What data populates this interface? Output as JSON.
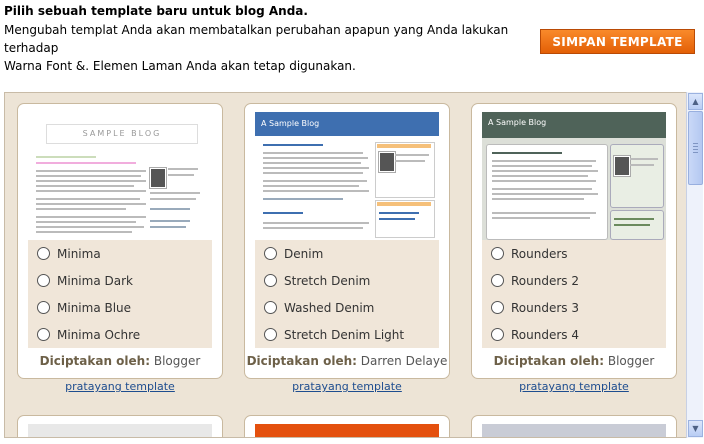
{
  "intro": {
    "title": "Pilih sebuah template baru untuk blog Anda.",
    "line1": "Mengubah templat Anda akan membatalkan perubahan apapun yang Anda lakukan terhadap",
    "line2": "Warna Font &. Elemen Laman Anda akan tetap digunakan."
  },
  "save_button": "SIMPAN TEMPLATE",
  "credit_label": "Diciptakan oleh:",
  "preview_label": "pratayang template",
  "cards": [
    {
      "thumbnail_title": "SAMPLE BLOG",
      "options": [
        "Minima",
        "Minima Dark",
        "Minima Blue",
        "Minima Ochre"
      ],
      "author": "Blogger"
    },
    {
      "thumbnail_title": "A Sample Blog",
      "options": [
        "Denim",
        "Stretch Denim",
        "Washed Denim",
        "Stretch Denim Light"
      ],
      "author": "Darren Delaye"
    },
    {
      "thumbnail_title": "A Sample Blog",
      "options": [
        "Rounders",
        "Rounders 2",
        "Rounders 3",
        "Rounders 4"
      ],
      "author": "Blogger"
    }
  ],
  "colors": {
    "accent": "#f07117",
    "gallery_bg": "#ede4d6",
    "options_bg": "#f0e6d9",
    "link": "#1e4d8f"
  },
  "icons": [
    "radio-button-icon",
    "scroll-up-icon",
    "scroll-down-icon"
  ]
}
